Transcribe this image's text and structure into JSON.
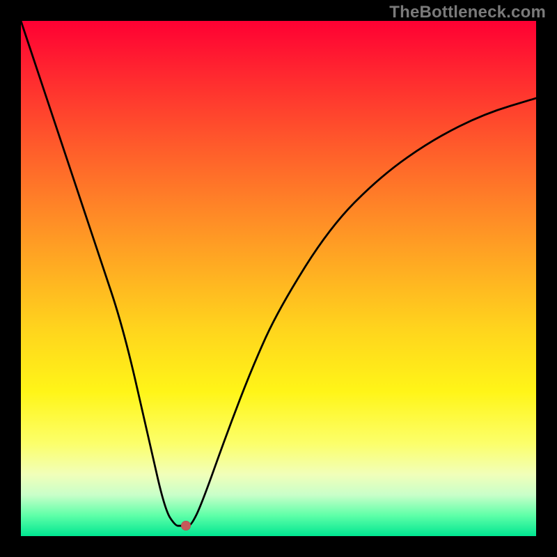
{
  "watermark": "TheBottleneck.com",
  "chart_data": {
    "type": "line",
    "title": "",
    "xlabel": "",
    "ylabel": "",
    "xlim": [
      0,
      1
    ],
    "ylim": [
      0,
      1
    ],
    "x": [
      0.0,
      0.05,
      0.1,
      0.15,
      0.2,
      0.25,
      0.28,
      0.3,
      0.31,
      0.32,
      0.33,
      0.35,
      0.4,
      0.45,
      0.5,
      0.6,
      0.7,
      0.8,
      0.9,
      1.0
    ],
    "values": [
      1.0,
      0.85,
      0.7,
      0.55,
      0.4,
      0.18,
      0.05,
      0.02,
      0.02,
      0.02,
      0.02,
      0.06,
      0.2,
      0.33,
      0.44,
      0.6,
      0.7,
      0.77,
      0.82,
      0.85
    ],
    "marker": {
      "x": 0.32,
      "y": 0.02
    },
    "gradient_stops": [
      {
        "pos": 0.0,
        "color": "#ff0033"
      },
      {
        "pos": 0.5,
        "color": "#ffc020"
      },
      {
        "pos": 0.8,
        "color": "#fff56a"
      },
      {
        "pos": 1.0,
        "color": "#00e691"
      }
    ]
  }
}
